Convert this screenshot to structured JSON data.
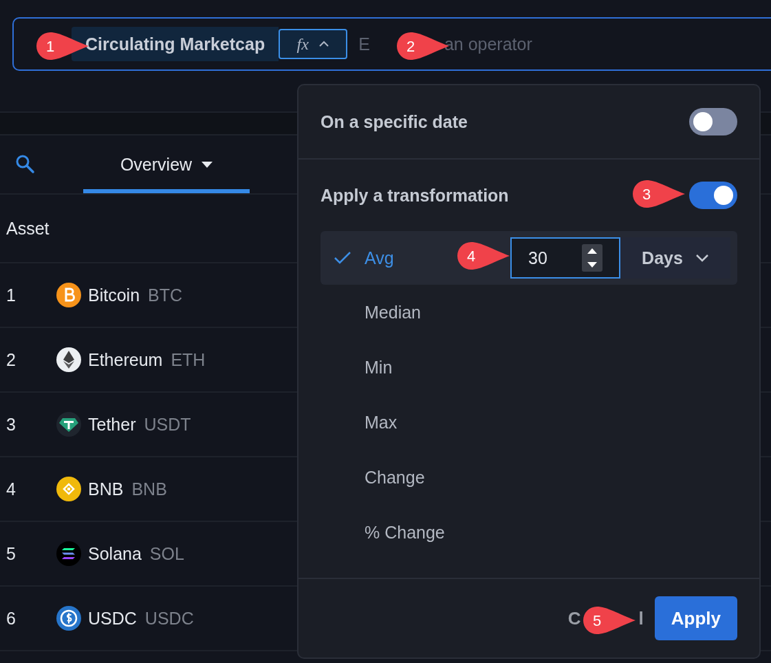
{
  "formula_bar": {
    "metric": "Circulating Marketcap",
    "fx_label": "fx",
    "placeholder_parts": [
      "E",
      "an operator"
    ]
  },
  "tabs": [
    {
      "label": "Overview",
      "selected": true
    }
  ],
  "table": {
    "columns": [
      "Asset"
    ],
    "rows": [
      {
        "rank": "1",
        "name": "Bitcoin",
        "symbol": "BTC",
        "kind": "btc"
      },
      {
        "rank": "2",
        "name": "Ethereum",
        "symbol": "ETH",
        "kind": "eth"
      },
      {
        "rank": "3",
        "name": "Tether",
        "symbol": "USDT",
        "kind": "usdt"
      },
      {
        "rank": "4",
        "name": "BNB",
        "symbol": "BNB",
        "kind": "bnb"
      },
      {
        "rank": "5",
        "name": "Solana",
        "symbol": "SOL",
        "kind": "sol"
      },
      {
        "rank": "6",
        "name": "USDC",
        "symbol": "USDC",
        "kind": "usdc"
      }
    ]
  },
  "popover": {
    "toggles": [
      {
        "label": "On a specific date",
        "on": false
      },
      {
        "label": "Apply a transformation",
        "on": true
      }
    ],
    "options": [
      {
        "label": "Avg",
        "selected": true
      },
      {
        "label": "Median",
        "selected": false
      },
      {
        "label": "Min",
        "selected": false
      },
      {
        "label": "Max",
        "selected": false
      },
      {
        "label": "Change",
        "selected": false
      },
      {
        "label": "% Change",
        "selected": false
      }
    ],
    "period": {
      "value": "30",
      "unit": "Days"
    },
    "buttons": [
      {
        "label_parts": [
          "C",
          "l"
        ],
        "kind": "secondary"
      },
      {
        "label": "Apply",
        "kind": "primary"
      }
    ]
  },
  "annotations": [
    "1",
    "2",
    "3",
    "4",
    "5"
  ]
}
